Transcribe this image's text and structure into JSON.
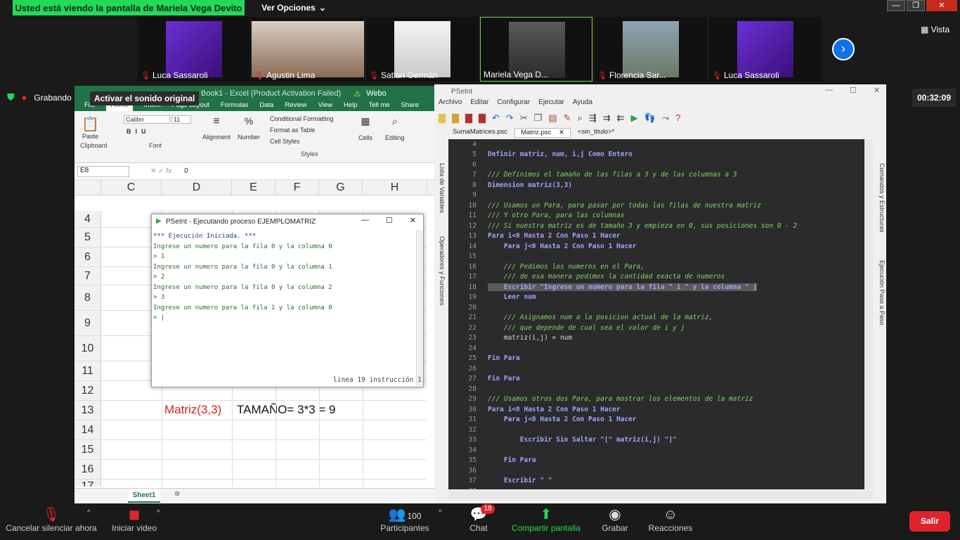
{
  "zoom": {
    "banner": "Usted está viendo la pantalla de Mariela Vega Devito",
    "view_options": "Ver Opciones",
    "view_label": "Vista",
    "recording": "Grabando",
    "tooltip": "Activar el sonido original",
    "timer": "00:32:09",
    "participants": [
      {
        "name": "Luca Sassaroli"
      },
      {
        "name": "Agustin Lima"
      },
      {
        "name": "Satlari Germán"
      },
      {
        "name": "Mariela Vega D..."
      },
      {
        "name": "Florencia Sar..."
      },
      {
        "name": "Luca Sassaroli"
      }
    ],
    "toolbar": {
      "mute": "Cancelar silenciar ahora",
      "video": "Iniciar video",
      "participants": "Participantes",
      "participants_count": "100",
      "chat": "Chat",
      "chat_badge": "18",
      "share": "Compartir pantalla",
      "record": "Grabar",
      "reactions": "Reacciones",
      "leave": "Salir"
    }
  },
  "excel": {
    "title": "Book1 - Excel (Product Activation Failed)",
    "user": "Webo",
    "menu": [
      "File",
      "Home",
      "Insert",
      "Page Layout",
      "Formulas",
      "Data",
      "Review",
      "View",
      "Help",
      "Tell me",
      "Share"
    ],
    "ribbon": {
      "paste": "Paste",
      "clipboard": "Clipboard",
      "font_name": "Calibri",
      "font_size": "11",
      "font": "Font",
      "alignment": "Alignment",
      "number": "Number",
      "cond_format": "Conditional Formatting",
      "format_table": "Format as Table",
      "cell_styles": "Cell Styles",
      "styles": "Styles",
      "cells": "Cells",
      "editing": "Editing"
    },
    "name_box": "E8",
    "formula_value": "0",
    "columns": [
      "C",
      "D",
      "E",
      "F",
      "G",
      "H"
    ],
    "rows": [
      "4",
      "5",
      "6",
      "7",
      "8",
      "9",
      "10",
      "11",
      "12",
      "13",
      "14",
      "15",
      "16",
      "17"
    ],
    "cell_d13": "Matriz(3,3)",
    "cell_e13": "TAMAÑO= 3*3 = 9",
    "sheet_tab": "Sheet1"
  },
  "console": {
    "title": "PSeInt - Ejecutando proceso EJEMPLOMATRIZ",
    "lines": [
      "*** Ejecución Iniciada. ***",
      "Ingrese un numero para la fila 0 y la columna 0",
      "> 1",
      "Ingrese un numero para la fila 0 y la columna 1",
      "> 2",
      "Ingrese un numero para la fila 0 y la columna 2",
      "> 3",
      "Ingrese un numero para la fila 1 y la columna 0",
      "> |"
    ],
    "status": "linea 19 instrucción 1"
  },
  "ide": {
    "title": "PSeInt",
    "menu": [
      "Archivo",
      "Editar",
      "Configurar",
      "Ejecutar",
      "Ayuda"
    ],
    "tabs": [
      "SumaMatrices.psc",
      "Matriz.psc",
      "<sin_titulo>*"
    ],
    "side_left": [
      "Lista de Variables",
      "Operadores y Funciones"
    ],
    "side_right": [
      "Comandos y Estructuras",
      "Ejecución Paso a Paso"
    ],
    "code": [
      {
        "n": "4",
        "t": ""
      },
      {
        "n": "5",
        "t": "Definir matriz, num, i,j Como Entero"
      },
      {
        "n": "6",
        "t": ""
      },
      {
        "n": "7",
        "t": "/// Definimos el tamaño de las filas a 3 y de las columnas a 3"
      },
      {
        "n": "8",
        "t": "Dimension matriz(3,3)"
      },
      {
        "n": "9",
        "t": ""
      },
      {
        "n": "10",
        "t": "/// Usamos un Para, para pasar por todas las filas de nuestra matriz"
      },
      {
        "n": "11",
        "t": "/// Y otro Para, para las columnas"
      },
      {
        "n": "12",
        "t": "/// Si nuestra matriz es de tamaño 3 y empieza en 0, sus posiciones son 0 - 2"
      },
      {
        "n": "13",
        "t": "Para i<0 Hasta 2 Con Paso 1 Hacer"
      },
      {
        "n": "14",
        "t": "    Para j<0 Hasta 2 Con Paso 1 Hacer"
      },
      {
        "n": "15",
        "t": ""
      },
      {
        "n": "16",
        "t": "    /// Pedimos los numeros en el Para,"
      },
      {
        "n": "17",
        "t": "    /// de esa manera pedimos la cantidad exacta de numeros"
      },
      {
        "n": "18",
        "t": "    Escribir \"Ingrese un numero para la fila \" i \" y la columna \" j"
      },
      {
        "n": "19",
        "t": "    Leer num"
      },
      {
        "n": "20",
        "t": ""
      },
      {
        "n": "21",
        "t": "    /// Asignamos num a la posicion actual de la matriz,"
      },
      {
        "n": "22",
        "t": "    /// que depende de cual sea el valor de i y j"
      },
      {
        "n": "23",
        "t": "    matriz(i,j) = num"
      },
      {
        "n": "24",
        "t": ""
      },
      {
        "n": "25",
        "t": "Fin Para"
      },
      {
        "n": "26",
        "t": ""
      },
      {
        "n": "27",
        "t": "Fin Para"
      },
      {
        "n": "28",
        "t": ""
      },
      {
        "n": "29",
        "t": "/// Usamos otros dos Para, para mostrar los elementos de la matriz"
      },
      {
        "n": "30",
        "t": "Para i<0 Hasta 2 Con Paso 1 Hacer"
      },
      {
        "n": "31",
        "t": "    Para j<0 Hasta 2 Con Paso 1 Hacer"
      },
      {
        "n": "32",
        "t": ""
      },
      {
        "n": "33",
        "t": "        Escribir Sin Saltar \"[\" matriz(i,j) \"]\""
      },
      {
        "n": "34",
        "t": ""
      },
      {
        "n": "35",
        "t": "    Fin Para"
      },
      {
        "n": "36",
        "t": ""
      },
      {
        "n": "37",
        "t": "    Escribir \" \""
      },
      {
        "n": "38",
        "t": ""
      }
    ]
  }
}
